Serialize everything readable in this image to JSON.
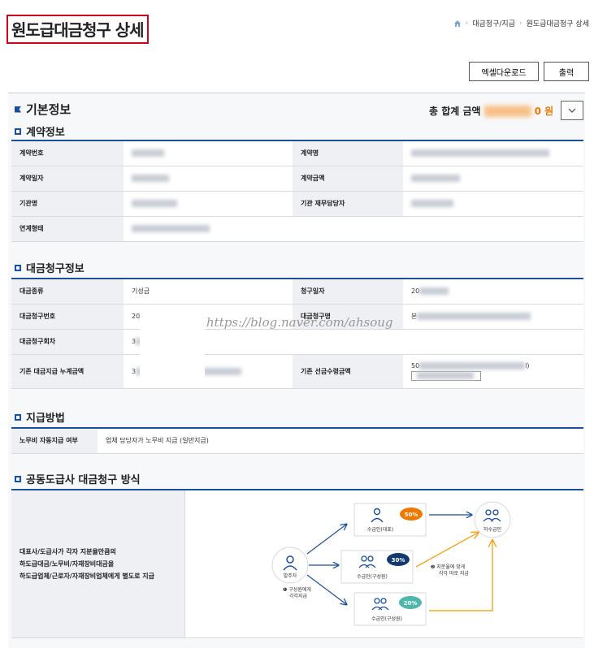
{
  "page": {
    "title": "원도급대금청구 상세",
    "breadcrumb": [
      "대금청구/지급",
      "원도급대금청구 상세"
    ]
  },
  "toolbar": {
    "excel_label": "엑셀다운로드",
    "print_label": "출력"
  },
  "basic": {
    "title": "기본정보",
    "total_label": "총 합계 금액",
    "total_amount_visible": "0 원"
  },
  "contract": {
    "title": "계약정보",
    "rows": [
      [
        {
          "label": "계약번호"
        },
        {
          "label": "계약명"
        }
      ],
      [
        {
          "label": "계약일자"
        },
        {
          "label": "계약금액"
        }
      ],
      [
        {
          "label": "기관명"
        },
        {
          "label": "기관 재무담당자"
        }
      ],
      [
        {
          "label": "연계형태"
        }
      ]
    ]
  },
  "claim": {
    "title": "대금청구정보",
    "rows": [
      [
        {
          "label": "대금종류",
          "value": "기성금"
        },
        {
          "label": "청구일자",
          "value": "20"
        }
      ],
      [
        {
          "label": "대금청구번호",
          "value": "20"
        },
        {
          "label": "대금청구명",
          "value": "본"
        }
      ],
      [
        {
          "label": "대금청구회차",
          "value": "3"
        }
      ],
      [
        {
          "label": "기존 대금지급 누계금액",
          "value": "3"
        },
        {
          "label": "기존 선금수령금액",
          "value": "50",
          "value_suffix": "l)"
        }
      ]
    ]
  },
  "payment": {
    "title": "지급방법",
    "label": "노무비 자동지급 여부",
    "value": "업체 담당자가 노무비 지급 (일반지급)"
  },
  "joint": {
    "title": "공동도급사 대금청구 방식",
    "description": "대표사/도급사가 각자 지분율만큼의\n하도급대금/노무비/자재장비대금을\n하도급업체/근로자/자재장비업체에게 별도로 지급",
    "diagram": {
      "orderer": "발주자",
      "rep": "수급인(대표)",
      "member1": "수급인(구성원)",
      "member2": "수급인(구성원)",
      "sub": "하수급인",
      "pct_rep": "50%",
      "pct_m1": "30%",
      "pct_m2": "20%",
      "step1": "❶ 구성원에게\n각각지급",
      "step2": "❷ 지분율에 맞게\n각각 따로 지급"
    },
    "colors": {
      "accent": "#1a4e9e",
      "orange": "#f07800",
      "teal": "#4bb8a9",
      "navy": "#12396e"
    }
  },
  "watermark": "https://blog.naver.com/ahsoug"
}
